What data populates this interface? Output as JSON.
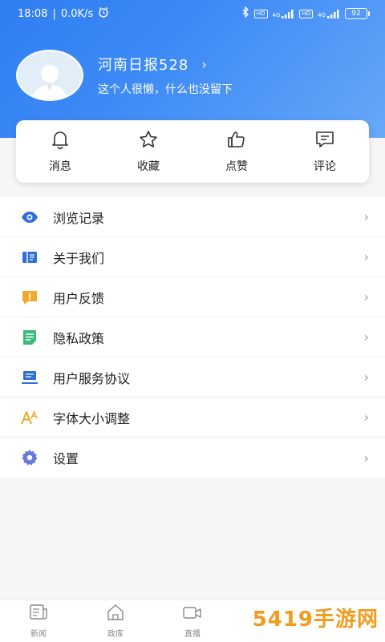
{
  "status_bar": {
    "time": "18:08",
    "speed": "0.0K/s",
    "hd1": "HD",
    "net1": "4G",
    "hd2": "HD",
    "net2": "4G",
    "battery": "92"
  },
  "profile": {
    "username": "河南日报528",
    "bio": "这个人很懒，什么也没留下"
  },
  "actions": [
    {
      "label": "消息",
      "icon": "bell-icon"
    },
    {
      "label": "收藏",
      "icon": "star-icon"
    },
    {
      "label": "点赞",
      "icon": "thumbs-up-icon"
    },
    {
      "label": "评论",
      "icon": "comment-icon"
    }
  ],
  "menu": [
    {
      "label": "浏览记录",
      "icon": "eye-icon",
      "color": "#2f6fd6"
    },
    {
      "label": "关于我们",
      "icon": "book-icon",
      "color": "#2f6fd6"
    },
    {
      "label": "用户反馈",
      "icon": "feedback-icon",
      "color": "#f0a92a"
    },
    {
      "label": "隐私政策",
      "icon": "document-icon",
      "color": "#3dbb7a"
    },
    {
      "label": "用户服务协议",
      "icon": "laptop-icon",
      "color": "#2f6fd6"
    },
    {
      "label": "字体大小调整",
      "icon": "font-size-icon",
      "color": "#f0a92a"
    },
    {
      "label": "设置",
      "icon": "gear-icon",
      "color": "#6a7ad8"
    }
  ],
  "bottom_nav": [
    {
      "label": "新闻",
      "icon": "news-icon"
    },
    {
      "label": "政库",
      "icon": "home-icon"
    },
    {
      "label": "直播",
      "icon": "live-icon"
    }
  ],
  "watermark": "5419手游网"
}
